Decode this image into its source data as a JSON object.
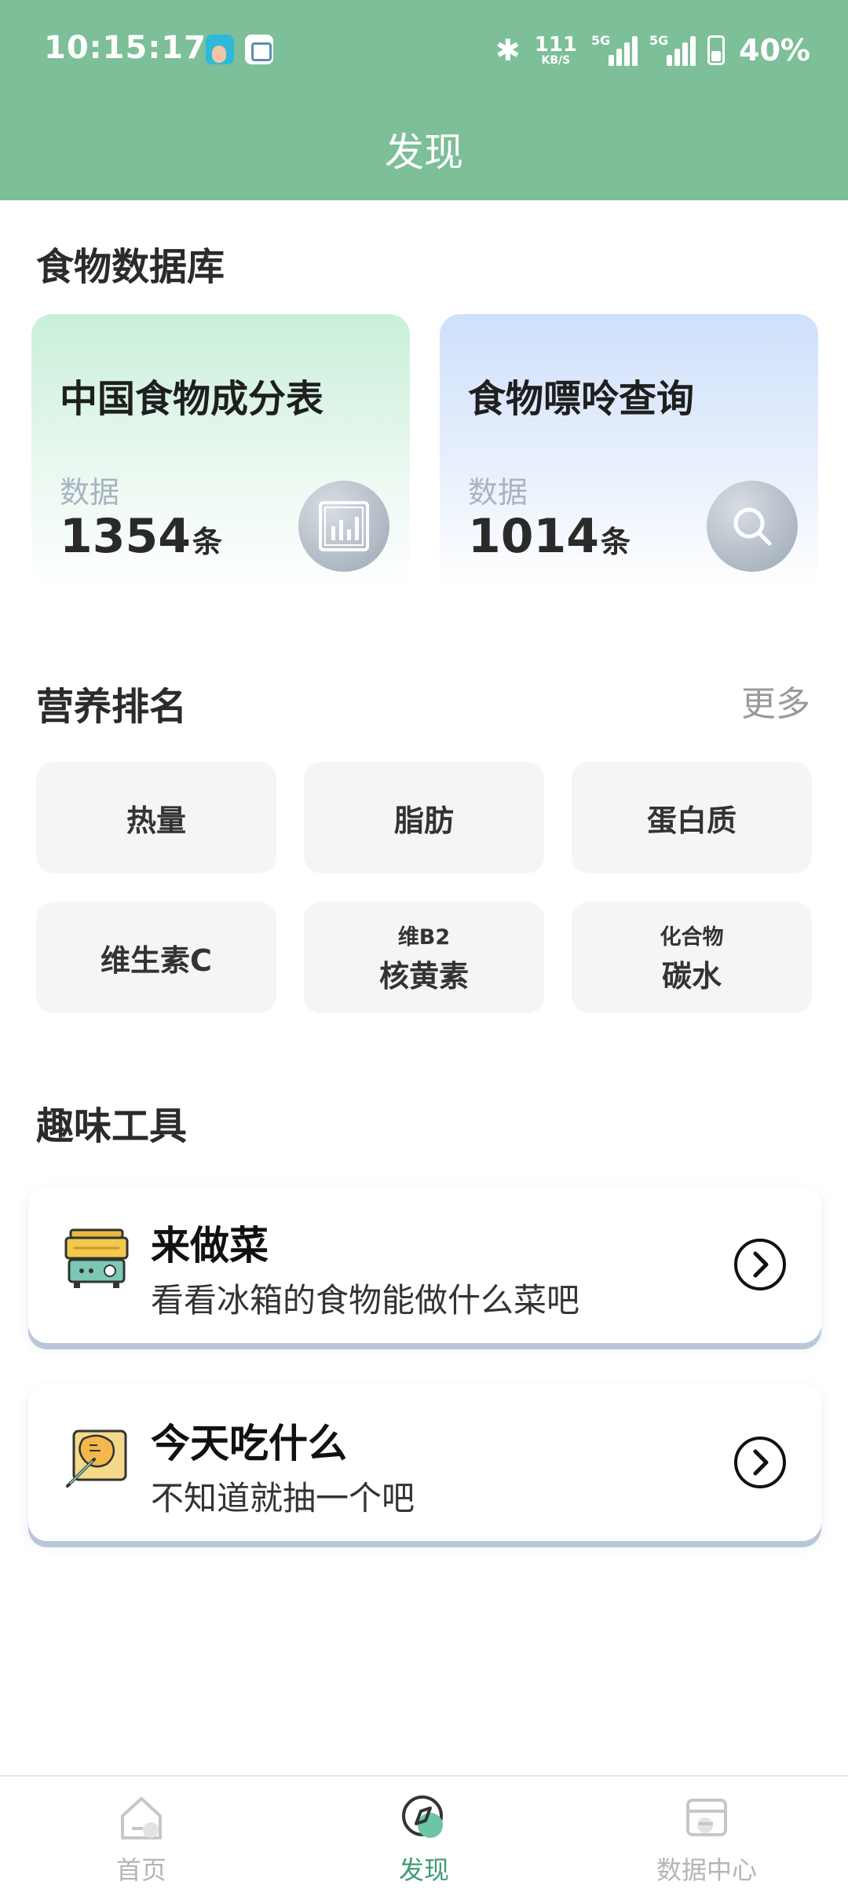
{
  "status_bar": {
    "time": "10:15:17",
    "net_speed": "111",
    "net_unit": "KB/S",
    "sig1_tag": "5G",
    "sig2_tag": "5G",
    "battery": "40%"
  },
  "header": {
    "title": "发现"
  },
  "food_db": {
    "title": "食物数据库",
    "cards": [
      {
        "title": "中国食物成分表",
        "sub": "数据",
        "count": "1354",
        "unit": "条",
        "icon": "chart-icon"
      },
      {
        "title": "食物嘌呤查询",
        "sub": "数据",
        "count": "1014",
        "unit": "条",
        "icon": "search-icon"
      }
    ]
  },
  "nutrition": {
    "title": "营养排名",
    "more": "更多",
    "items": [
      {
        "label": "热量"
      },
      {
        "label": "脂肪"
      },
      {
        "label": "蛋白质"
      },
      {
        "label": "维生素C"
      },
      {
        "small": "维B2",
        "label": "核黄素"
      },
      {
        "small": "化合物",
        "label": "碳水"
      }
    ]
  },
  "tools": {
    "title": "趣味工具",
    "items": [
      {
        "title": "来做菜",
        "desc": "看看冰箱的食物能做什么菜吧",
        "icon": "cooking-pot-icon"
      },
      {
        "title": "今天吃什么",
        "desc": "不知道就抽一个吧",
        "icon": "food-plate-icon"
      }
    ]
  },
  "bottom_nav": [
    {
      "label": "首页",
      "icon": "home-icon"
    },
    {
      "label": "发现",
      "icon": "compass-icon",
      "active": true
    },
    {
      "label": "数据中心",
      "icon": "data-center-icon"
    }
  ],
  "colors": {
    "header": "#7cbf98",
    "active_nav": "#3f9c74"
  }
}
